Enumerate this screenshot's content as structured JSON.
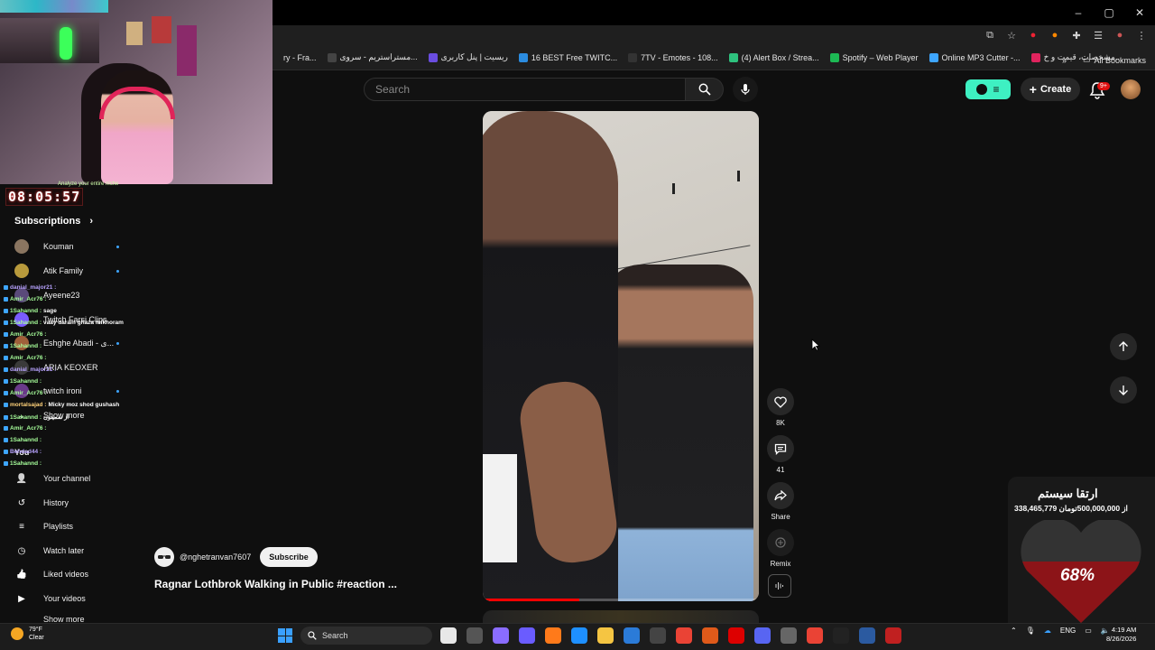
{
  "window": {
    "controls": {
      "minimize": "–",
      "maximize": "▢",
      "close": "✕"
    }
  },
  "bookmarks": {
    "items": [
      {
        "label": "ry - Fra...",
        "color": "#1f1f1f"
      },
      {
        "label": "مستراستریم - سروی...",
        "color": "#444"
      },
      {
        "label": "ریسیت | پنل کاربری",
        "color": "#6a4de0"
      },
      {
        "label": "16 BEST Free TWITC...",
        "color": "#2b8ce0"
      },
      {
        "label": "7TV - Emotes - 108...",
        "color": "#333"
      },
      {
        "label": "(4) Alert Box / Strea...",
        "color": "#2ec27e"
      },
      {
        "label": "Spotify – Web Player",
        "color": "#1db954"
      },
      {
        "label": "Online MP3 Cutter -...",
        "color": "#3ea6ff"
      },
      {
        "label": "مشخصات، قیمت و خ...",
        "color": "#e0245e"
      }
    ],
    "more": "»",
    "all_label": "All Bookmarks"
  },
  "header": {
    "search_placeholder": "Search",
    "create_label": "Create",
    "notification_count": "9+"
  },
  "stream_overlay": {
    "timer": "08:05:57",
    "caption": "Analyze your entire niche"
  },
  "sidebar": {
    "subscriptions_title": "Subscriptions",
    "subscriptions": [
      {
        "label": "Kouman",
        "color": "#8a7560",
        "new": true
      },
      {
        "label": "Atik Family",
        "color": "#b89a3c",
        "new": true
      },
      {
        "label": "Ayeene23",
        "color": "#5a4a7a",
        "new": false
      },
      {
        "label": "Twitch Farsi Clips",
        "color": "#7a5cff",
        "new": false
      },
      {
        "label": "Eshghe Abadi - ی...",
        "color": "#a0603a",
        "new": true
      },
      {
        "label": "ARIA KEOXER",
        "color": "#3a3a3a",
        "new": false
      },
      {
        "label": "twitch ironi",
        "color": "#6a3a8a",
        "new": true
      }
    ],
    "show_more": "Show more",
    "you_title": "You",
    "you_items": [
      {
        "label": "Your channel",
        "icon": "person-box-icon"
      },
      {
        "label": "History",
        "icon": "history-icon"
      },
      {
        "label": "Playlists",
        "icon": "playlists-icon"
      },
      {
        "label": "Watch later",
        "icon": "clock-icon"
      },
      {
        "label": "Liked videos",
        "icon": "thumbs-up-icon"
      },
      {
        "label": "Your videos",
        "icon": "play-box-icon"
      }
    ],
    "show_more_2": "Show more"
  },
  "chat": [
    {
      "name": "danial_major21 :",
      "msg": "",
      "cls": "n1"
    },
    {
      "name": "Amir_Acr76 :",
      "msg": "",
      "cls": "n2"
    },
    {
      "name": "1Sahannd :",
      "msg": "sage",
      "cls": "n2"
    },
    {
      "name": "1Sahannd :",
      "msg": "vaay daram ghaza mikhoram",
      "cls": "n2"
    },
    {
      "name": "Amir_Acr76 :",
      "msg": "",
      "cls": "n2"
    },
    {
      "name": "1Sahannd :",
      "msg": "",
      "cls": "n2"
    },
    {
      "name": "Amir_Acr76 :",
      "msg": "",
      "cls": "n2"
    },
    {
      "name": "danial_major21 :",
      "msg": "",
      "cls": "n1"
    },
    {
      "name": "1Sahannd :",
      "msg": "",
      "cls": "n2"
    },
    {
      "name": "Amir_Acr76 :",
      "msg": "",
      "cls": "n2"
    },
    {
      "name": "mortalsajad :",
      "msg": "Micky moz shod gushash",
      "cls": "n3"
    },
    {
      "name": "1Sahannd :",
      "msg": "از سمیتون",
      "cls": "n2"
    },
    {
      "name": "Amir_Acr76 :",
      "msg": "",
      "cls": "n2"
    },
    {
      "name": "1Sahannd :",
      "msg": "",
      "cls": "n2"
    },
    {
      "name": "Behdad44 :",
      "msg": "",
      "cls": "n1"
    },
    {
      "name": "1Sahannd :",
      "msg": "",
      "cls": "n2"
    }
  ],
  "short": {
    "channel": "@nghetranvan7607",
    "subscribe_label": "Subscribe",
    "title": "Ragnar Lothbrok Walking in Public #reaction ...",
    "progress": 0.35,
    "likes": "8K",
    "comments": "41",
    "share_label": "Share",
    "remix_label": "Remix"
  },
  "donation": {
    "title": "ارتقا سیستم",
    "amount_text": "338,465,779 از 500,000,000تومان",
    "percent_label": "68%",
    "percent": 0.68
  },
  "taskbar": {
    "weather_temp": "79°F",
    "weather_desc": "Clear",
    "search_label": "Search",
    "lang": "ENG",
    "time": "4:19 AM",
    "date": "8/26/2026",
    "app_colors": [
      "#e8e8e8",
      "#555",
      "#8a6cff",
      "#6a5cff",
      "#ff7a1a",
      "#1e90ff",
      "#f5c542",
      "#2b7bd8",
      "#444",
      "#ea4335",
      "#e05a1a",
      "#d00",
      "#5865f2",
      "#666",
      "#ea4335",
      "#222",
      "#2b5aa0",
      "#c02020"
    ]
  }
}
